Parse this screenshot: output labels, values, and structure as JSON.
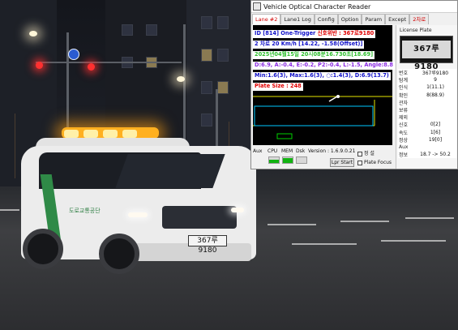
{
  "window": {
    "title": "Vehicle Optical Character Reader",
    "icon_label": ""
  },
  "tabs": [
    {
      "label": "Lane #2",
      "active": true
    },
    {
      "label": "Lane1 Log",
      "active": false
    },
    {
      "label": "Config",
      "active": false
    },
    {
      "label": "Option",
      "active": false
    },
    {
      "label": "Param",
      "active": false
    },
    {
      "label": "Except",
      "active": false
    },
    {
      "label": "2차로",
      "active": false
    }
  ],
  "overlay": {
    "line1_prefix": "ID [814] One-Trigger ",
    "line1_red": "신호위반 : 367로9180",
    "line2": "2 차로 20 Km/h [14.22, -1.58(Offset)]",
    "line3": "2025년04월15일 20시08분16.730초[18.69]",
    "line4": "D:6.9, A:-0.4, E:-0.2, P2:-0.4, L:-1.5, Angle:8.8",
    "line5": "Min:1.6(3), Max:1.6(3), ○:1.4(3), D:6.9(13.7)",
    "line6": "Plate Size : 248"
  },
  "bottombar": {
    "aux_label": "Aux",
    "cpu_label": "CPU",
    "mem_label": "MEM",
    "disk_label": "Dsk",
    "version_text": "Version : 1.6.9.0.21",
    "checkbox_label": "정 설",
    "start_button": "Lpr Start",
    "plate_focus_label": "Plate Focus",
    "cpu_level": 0.55,
    "mem_level": 0.85,
    "disk_level": 0.0
  },
  "right_panel": {
    "title": "License Plate",
    "plate_text": "367루9180",
    "rows": [
      {
        "key": "번호",
        "value": "367루9180"
      },
      {
        "key": "탐계",
        "value": "9"
      },
      {
        "key": "인식",
        "value": "1(11.1)"
      },
      {
        "key": "확인",
        "value": "8(88.9)"
      },
      {
        "key": "관자",
        "value": ""
      },
      {
        "key": "보류",
        "value": ""
      },
      {
        "key": "제외",
        "value": ""
      },
      {
        "key": "신호",
        "value": "0[2]"
      },
      {
        "key": "속도",
        "value": "1[6]"
      },
      {
        "key": "정상",
        "value": "19[0]"
      },
      {
        "key": "Aux",
        "value": ""
      },
      {
        "key": "정보",
        "value": "18.7 -> 50.2"
      }
    ]
  },
  "scene": {
    "van_plate": "367루9180",
    "van_logo": "도로교통공단"
  }
}
